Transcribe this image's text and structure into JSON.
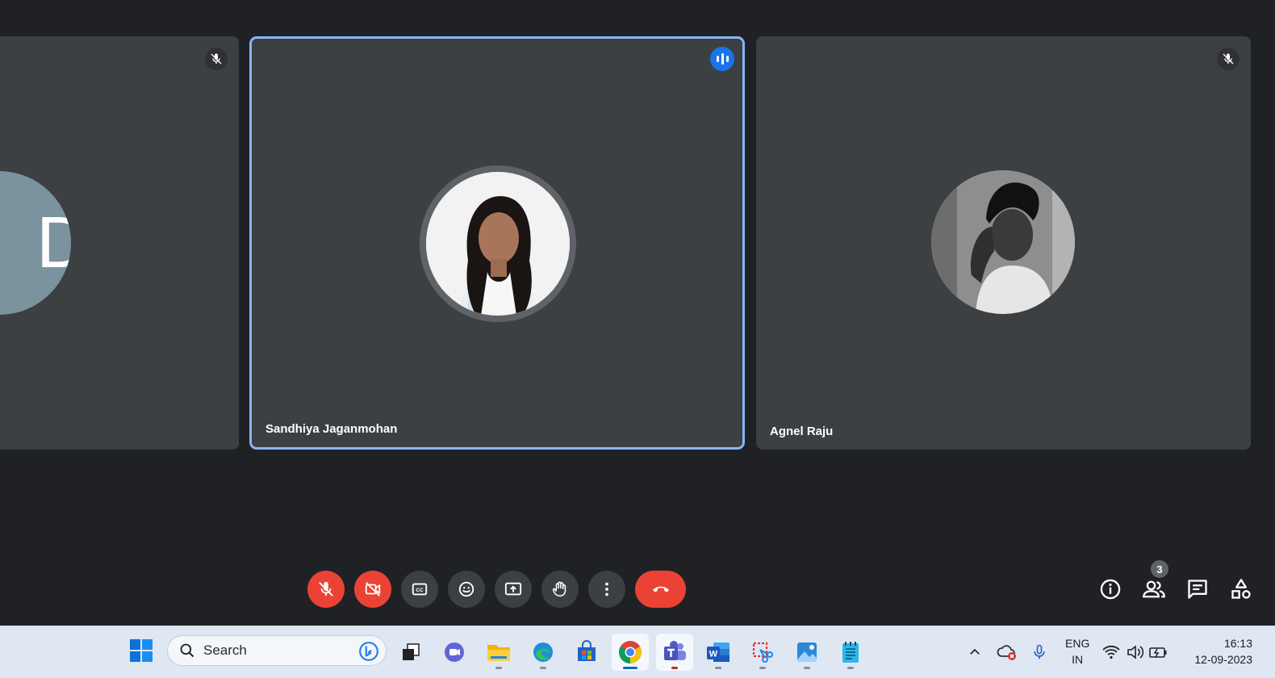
{
  "participants": [
    {
      "name": "",
      "avatar_letter": "D",
      "muted": true
    },
    {
      "name": "Sandhiya Jaganmohan",
      "muted": false,
      "speaking": true
    },
    {
      "name": "Agnel Raju",
      "muted": true
    }
  ],
  "controls": {
    "mic": "mic-off-icon",
    "camera": "camera-off-icon",
    "captions": "captions-icon",
    "reactions": "emoji-icon",
    "present": "present-screen-icon",
    "raise_hand": "raise-hand-icon",
    "more": "more-options-icon",
    "end_call": "end-call-icon"
  },
  "side_controls": {
    "participant_count": "3"
  },
  "taskbar": {
    "search_placeholder": "Search",
    "language": "ENG",
    "region": "IN",
    "time": "16:13",
    "date": "12-09-2023"
  },
  "colors": {
    "background": "#202124",
    "tile": "#3c4043",
    "active_border": "#8ab4f8",
    "danger": "#ea4335",
    "speaking": "#1a73e8"
  }
}
